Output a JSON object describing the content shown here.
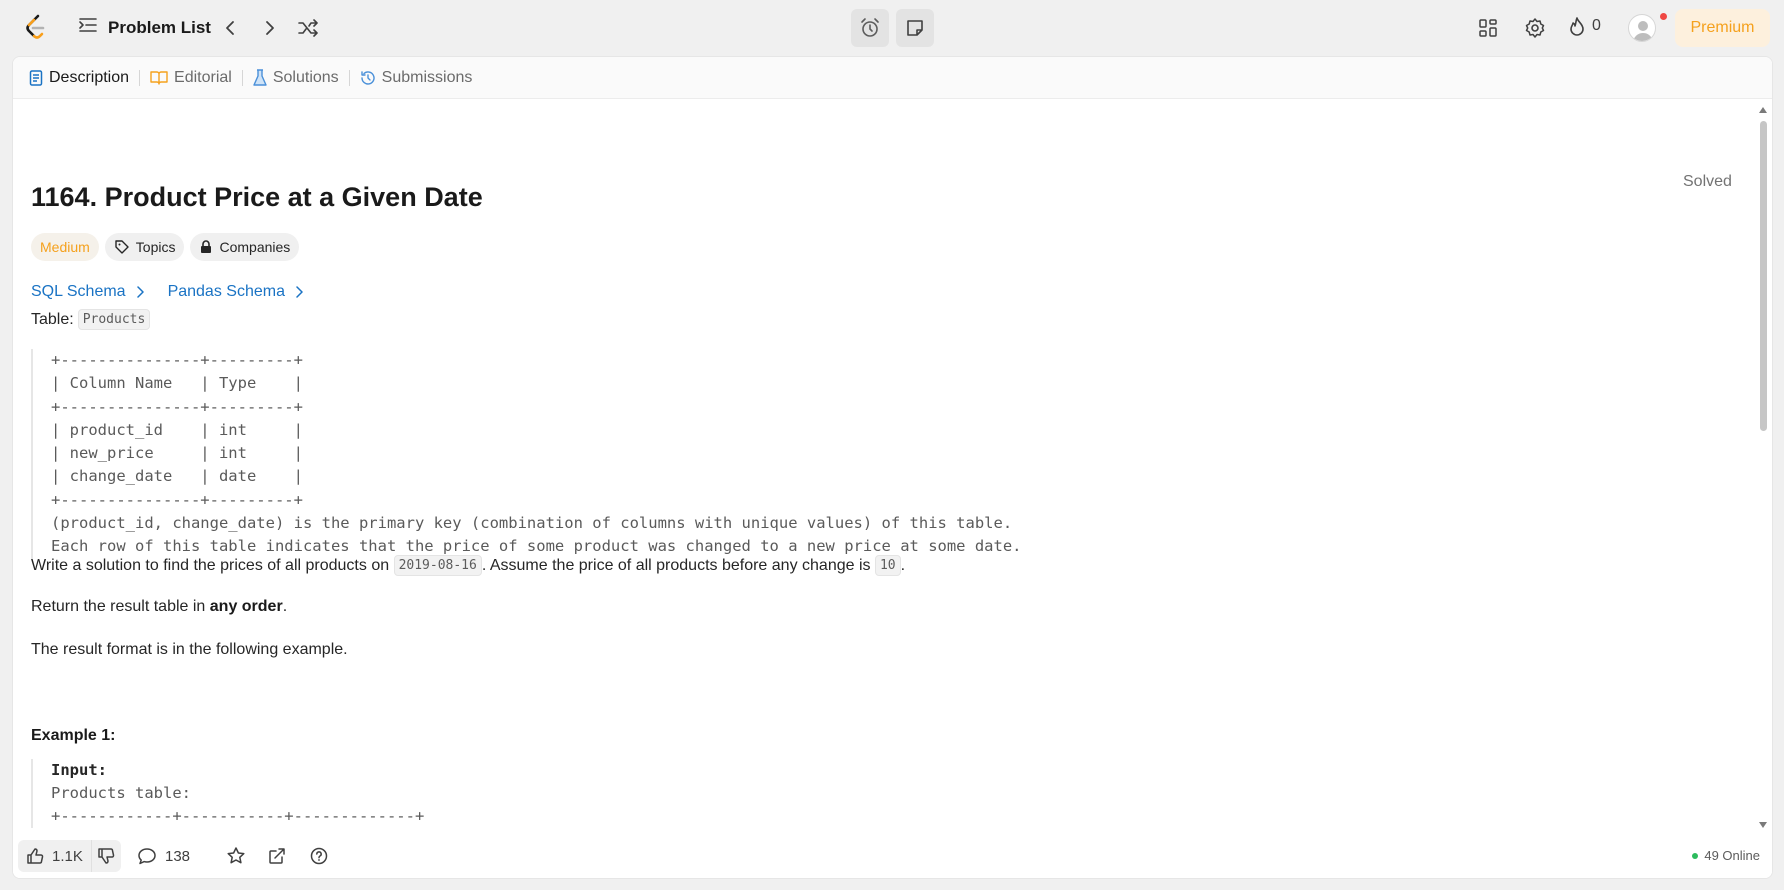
{
  "nav": {
    "problem_list_label": "Problem List",
    "streak_count": "0",
    "premium_label": "Premium"
  },
  "tabs": [
    {
      "label": "Description",
      "active": true
    },
    {
      "label": "Editorial"
    },
    {
      "label": "Solutions"
    },
    {
      "label": "Submissions"
    }
  ],
  "problem": {
    "title": "1164. Product Price at a Given Date",
    "status": "Solved",
    "difficulty": "Medium",
    "topics_label": "Topics",
    "companies_label": "Companies",
    "sql_schema": "SQL Schema",
    "pandas_schema": "Pandas Schema",
    "table_prefix": "Table:",
    "table_name": "Products",
    "schema_block": "+---------------+---------+\n| Column Name   | Type    |\n+---------------+---------+\n| product_id    | int     |\n| new_price     | int     |\n| change_date   | date    |\n+---------------+---------+\n(product_id, change_date) is the primary key (combination of columns with unique values) of this table.\nEach row of this table indicates that the price of some product was changed to a new price at some date.",
    "desc1_a": "Write a solution to find the prices of all products on ",
    "desc1_code1": "2019-08-16",
    "desc1_b": ". Assume the price of all products before any change is ",
    "desc1_code2": "10",
    "desc1_c": ".",
    "desc2_a": "Return the result table in ",
    "desc2_bold": "any order",
    "desc2_c": ".",
    "desc3": "The result format is in the following example.",
    "example_heading": "Example 1:",
    "example_input_label": "Input:",
    "example_line2": "Products table:",
    "example_line3": "+------------+-----------+-------------+"
  },
  "bottom": {
    "likes": "1.1K",
    "comments": "138",
    "online": "49 Online"
  },
  "colors": {
    "accent_blue": "#1a73c4",
    "medium_orange": "#f5a11d",
    "solved_green": "#2cbb5d"
  }
}
